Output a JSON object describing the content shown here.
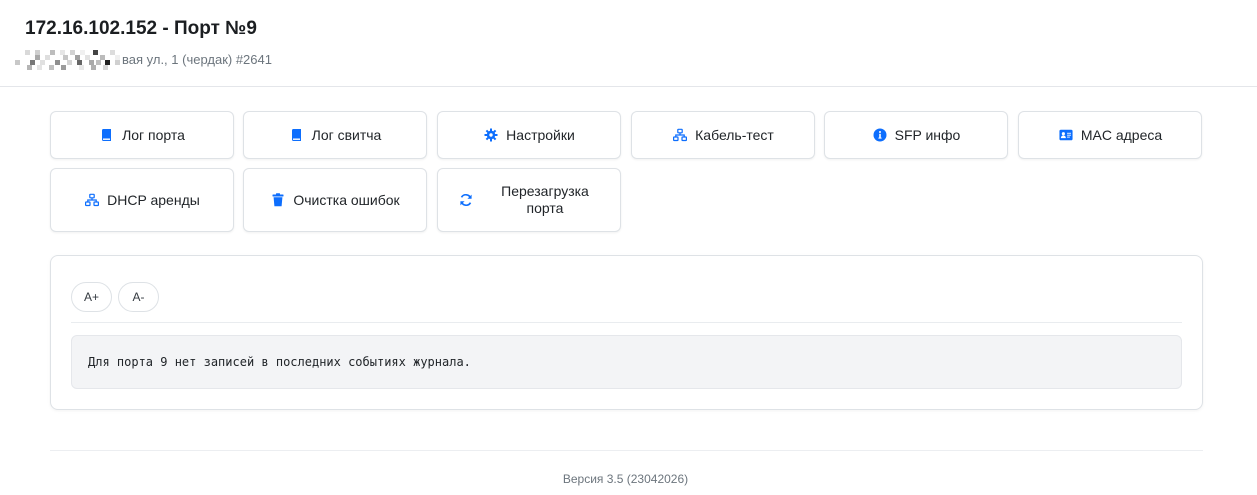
{
  "header": {
    "title": "172.16.102.152 - Порт №9",
    "address_visible": "вая ул., 1 (чердак) #2641"
  },
  "actions": [
    {
      "label": "Лог порта",
      "icon": "book-icon"
    },
    {
      "label": "Лог свитча",
      "icon": "book-icon"
    },
    {
      "label": "Настройки",
      "icon": "gear-icon"
    },
    {
      "label": "Кабель-тест",
      "icon": "network-icon"
    },
    {
      "label": "SFP инфо",
      "icon": "info-circle-icon"
    },
    {
      "label": "MAC адреса",
      "icon": "id-card-icon"
    },
    {
      "label": "DHCP аренды",
      "icon": "network-icon"
    },
    {
      "label": "Очистка ошибок",
      "icon": "trash-icon"
    },
    {
      "label": "Перезагрузка порта",
      "icon": "refresh-icon"
    }
  ],
  "log_panel": {
    "font_increase": "A+",
    "font_decrease": "A-",
    "message": "Для порта 9 нет записей в последних событиях журнала."
  },
  "footer": {
    "version": "Версия 3.5 (23042026)"
  },
  "colors": {
    "icon_blue": "#0d6efd",
    "border": "#dee2e6"
  }
}
